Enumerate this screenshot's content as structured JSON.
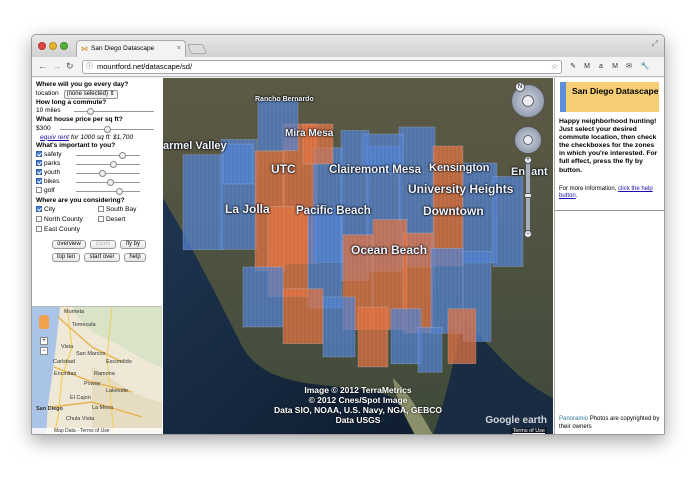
{
  "browser": {
    "tab_title": "San Diego Datascape",
    "url": "mountford.net/datascape/sd/"
  },
  "left_panel": {
    "q_where": "Where will you go every day?",
    "location_label": "location",
    "location_value": "(none selected)",
    "q_commute": "How long a commute?",
    "commute_value": "10 miles",
    "commute_level": 0.18,
    "q_price": "What house price per sq ft?",
    "price_value": "$300",
    "price_level": 0.5,
    "equiv_link": "equiv rent",
    "equiv_text": "for 1000 sq ft: $1,700",
    "q_important": "What's important to you?",
    "prefs": [
      {
        "label": "safety",
        "checked": true,
        "level": 0.75
      },
      {
        "label": "parks",
        "checked": true,
        "level": 0.6
      },
      {
        "label": "youth",
        "checked": true,
        "level": 0.4
      },
      {
        "label": "bikes",
        "checked": true,
        "level": 0.55
      },
      {
        "label": "golf",
        "checked": false,
        "level": 0.7
      }
    ],
    "q_zones": "Where are you considering?",
    "zones": [
      {
        "label": "City",
        "checked": true
      },
      {
        "label": "South Bay",
        "checked": false
      },
      {
        "label": "North County",
        "checked": false
      },
      {
        "label": "Desert",
        "checked": false
      },
      {
        "label": "East County",
        "checked": false
      }
    ],
    "buttons": {
      "overview": "overview",
      "zoom": "zoom",
      "flyby": "fly by",
      "topten": "top ten",
      "startover": "start over",
      "help": "help"
    }
  },
  "minimap": {
    "labels": [
      "Murrieta",
      "Temecula",
      "Vista",
      "San Marcos",
      "Escondido",
      "Carlsbad",
      "Ramona",
      "Encinitas",
      "Poway",
      "Lakeside",
      "El Cajon",
      "La Mesa",
      "San Diego",
      "Chula Vista"
    ],
    "footer": "Map Data - Terms of Use"
  },
  "earth_view": {
    "labels": [
      "Rancho Bernardo",
      "Mira Mesa",
      "armel Valley",
      "UTC",
      "Clairemont Mesa",
      "Kensington",
      "Encant",
      "University Heights",
      "La Jolla",
      "Pacific Beach",
      "Downtown",
      "Ocean Beach"
    ],
    "attribution": [
      "Image © 2012 TerraMetrics",
      "© 2012 Cnes/Spot Image",
      "Data SIO, NOAA, U.S. Navy, NGA, GEBCO",
      "Data USGS"
    ],
    "logo": "Google earth",
    "terms": "Terms of Use"
  },
  "right_panel": {
    "title": "San Diego Datascape",
    "intro": "Happy neighborhood hunting! Just select your desired commute location, then check the checkboxes for the zones in which you're interested. For full effect, press the fly by button.",
    "more_info": "For more information,",
    "help_link": "click the help button",
    "footer_brand": "Panoramio",
    "footer_text": "Photos are copyrighted by their owners"
  },
  "colors": {
    "accent_blue": "#5b8fd9",
    "title_bg": "#f5cd75",
    "tower_blue": "#4f7fd0",
    "tower_orange": "#e2703f"
  }
}
